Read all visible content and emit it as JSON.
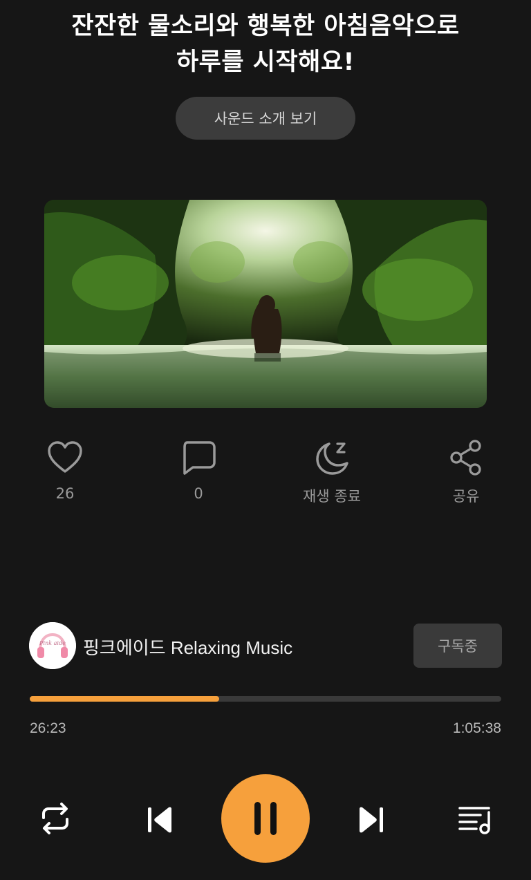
{
  "title": {
    "line1": "잔잔한 물소리와 행복한 아침음악으로",
    "line2": "하루를 시작해요!"
  },
  "intro_button": {
    "label": "사운드 소개 보기"
  },
  "artwork": {
    "description_icon": "forest-river-image"
  },
  "actions": {
    "like": {
      "icon": "heart-icon",
      "label": "26"
    },
    "comment": {
      "icon": "comment-icon",
      "label": "0"
    },
    "sleep_timer": {
      "icon": "moon-zz-icon",
      "label": "재생 종료"
    },
    "share": {
      "icon": "share-icon",
      "label": "공유"
    }
  },
  "channel": {
    "avatar_text": "Pink aide",
    "name": "핑크에이드 Relaxing Music",
    "subscribe_label": "구독중"
  },
  "player": {
    "elapsed": "26:23",
    "total": "1:05:38",
    "progress_fraction": 0.402,
    "accent_color": "#f6a03c"
  },
  "controls": {
    "repeat": "repeat-icon",
    "previous": "skip-previous-icon",
    "play_pause": "pause-icon",
    "next": "skip-next-icon",
    "playlist": "playlist-icon"
  }
}
